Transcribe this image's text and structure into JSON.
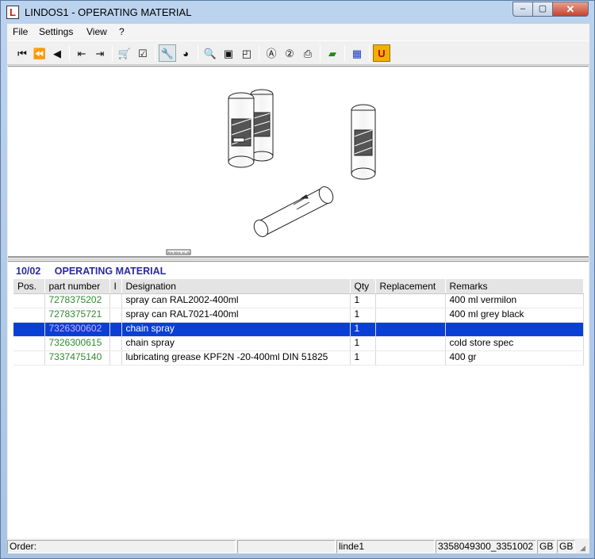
{
  "window": {
    "title": "LINDOS1 - OPERATING MATERIAL",
    "minimize": "‒",
    "maximize": "▢",
    "close": "✕",
    "app_icon": "L"
  },
  "menu": [
    "File",
    "Settings",
    "View",
    "?"
  ],
  "toolbar": {
    "buttons": [
      {
        "icon": "first-icon",
        "glyph": "⏮"
      },
      {
        "icon": "rewind-icon",
        "glyph": "⏪"
      },
      {
        "icon": "previous-icon",
        "glyph": "◀"
      },
      {
        "icon": "back-page-icon",
        "glyph": "⇤"
      },
      {
        "icon": "forward-page-icon",
        "glyph": "⇥"
      },
      {
        "icon": "cart-icon",
        "glyph": "🛒"
      },
      {
        "icon": "checklist-icon",
        "glyph": "☑"
      },
      {
        "icon": "wrench-icon",
        "glyph": "🔧"
      },
      {
        "icon": "globe-icon",
        "glyph": "◕"
      },
      {
        "icon": "zoom-icon",
        "glyph": "🔍"
      },
      {
        "icon": "page-icon",
        "glyph": "▣"
      },
      {
        "icon": "page-corner-icon",
        "glyph": "◰"
      },
      {
        "icon": "search-a-icon",
        "glyph": "Ⓐ"
      },
      {
        "icon": "search-2-icon",
        "glyph": "②"
      },
      {
        "icon": "print-icon",
        "glyph": "⎙"
      },
      {
        "icon": "green-book-icon",
        "glyph": "▰"
      },
      {
        "icon": "blue-grid-icon",
        "glyph": "▦"
      },
      {
        "icon": "u-icon",
        "glyph": "U"
      }
    ]
  },
  "drawing": {
    "label": "504 0004 10.25"
  },
  "group": {
    "number": "10/02",
    "title": "OPERATING MATERIAL"
  },
  "table": {
    "headers": [
      "Pos.",
      "part number",
      "I",
      "Designation",
      "Qty",
      "Replacement",
      "Remarks"
    ],
    "rows": [
      {
        "pos": "",
        "part": "7278375202",
        "i": "",
        "designation": "spray can RAL2002-400ml",
        "qty": "1",
        "replacement": "",
        "remarks": "400 ml vermilon"
      },
      {
        "pos": "",
        "part": "7278375721",
        "i": "",
        "designation": "spray can RAL7021-400ml",
        "qty": "1",
        "replacement": "",
        "remarks": "400 ml grey black"
      },
      {
        "pos": "",
        "part": "7326300602",
        "i": "",
        "designation": "chain spray",
        "qty": "1",
        "replacement": "",
        "remarks": ""
      },
      {
        "pos": "",
        "part": "7326300615",
        "i": "",
        "designation": "chain spray",
        "qty": "1",
        "replacement": "",
        "remarks": "cold store spec"
      },
      {
        "pos": "",
        "part": "7337475140",
        "i": "",
        "designation": "lubricating grease KPF2N -20-400ml  DIN 51825",
        "qty": "1",
        "replacement": "",
        "remarks": "400 gr"
      }
    ],
    "selected_row": 2
  },
  "statusbar": {
    "order": "Order:",
    "field2": "",
    "user": "linde1",
    "doc": "3358049300_3351002",
    "lang1": "GB",
    "lang2": "GB"
  },
  "colors": {
    "selection": "#0a3fd6",
    "part_number": "#2e8a2e",
    "group_title": "#2a2aa0"
  }
}
